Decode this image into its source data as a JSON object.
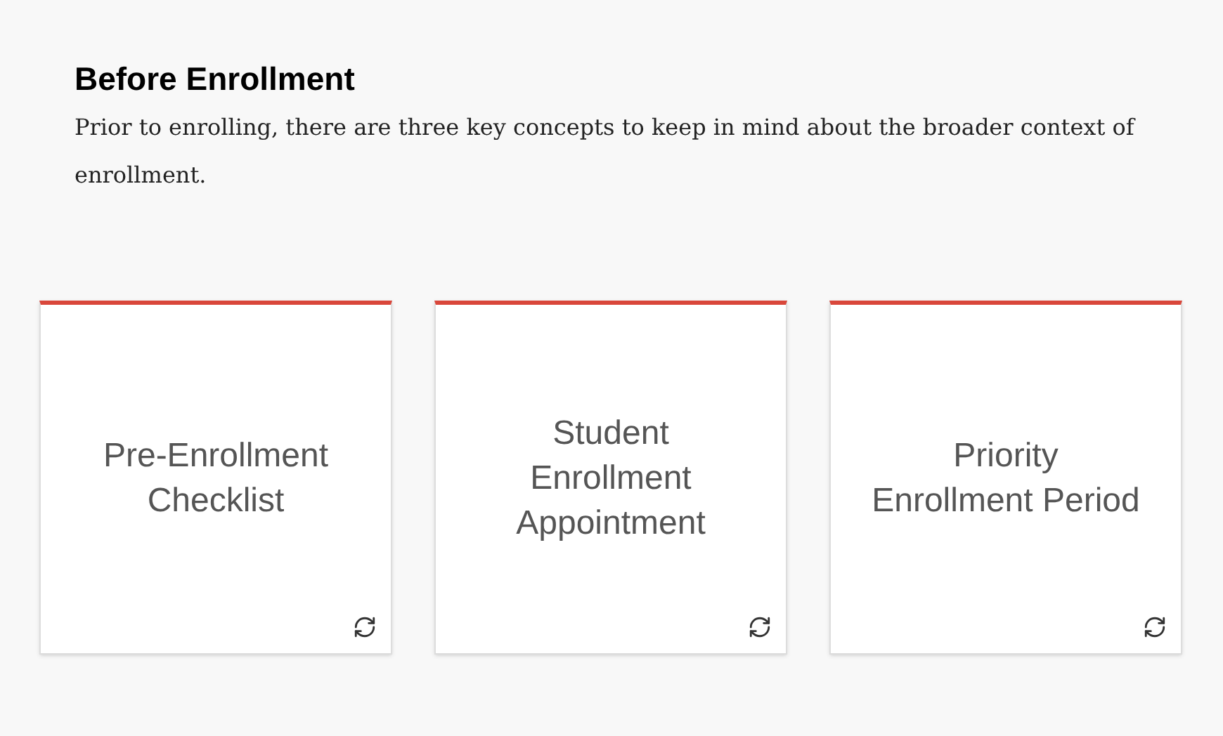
{
  "heading": "Before Enrollment",
  "intro": "Prior to enrolling, there are three key concepts to keep in mind about the broader context of enrollment.",
  "cards": [
    {
      "title": "Pre-Enrollment\nChecklist"
    },
    {
      "title": "Student\nEnrollment\nAppointment"
    },
    {
      "title": "Priority\nEnrollment Period"
    }
  ]
}
